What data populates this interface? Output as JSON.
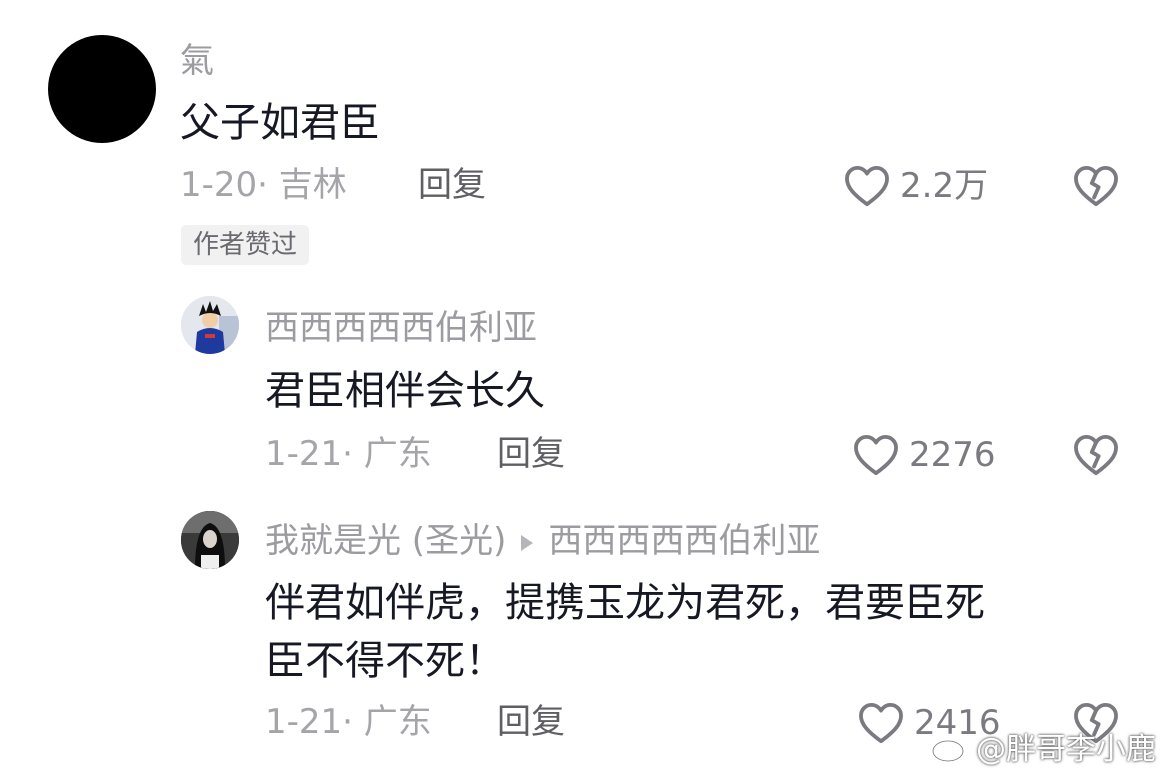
{
  "comments": [
    {
      "username": "氣",
      "content": "父子如君臣",
      "date_location": "1-20· 吉林",
      "reply_label": "回复",
      "likes": "2.2万",
      "author_badge": "作者赞过"
    },
    {
      "username": "西西西西西伯利亚",
      "content": "君臣相伴会长久",
      "date_location": "1-21· 广东",
      "reply_label": "回复",
      "likes": "2276"
    },
    {
      "username": "我就是光 (圣光)",
      "reply_to": "西西西西西伯利亚",
      "content_line1": "伴君如伴虎，提携玉龙为君死，君要臣死",
      "content_line2": "臣不得不死！",
      "date_location": "1-21· 广东",
      "reply_label": "回复",
      "likes": "2416"
    }
  ],
  "watermark": {
    "text": "@胖哥李小鹿",
    "icon": "weibo-icon"
  },
  "colors": {
    "username": "#9b9ba0",
    "content": "#161823",
    "meta": "#a4a4a9",
    "icon": "#7a7a80",
    "badge_bg": "#f1f1f2"
  }
}
